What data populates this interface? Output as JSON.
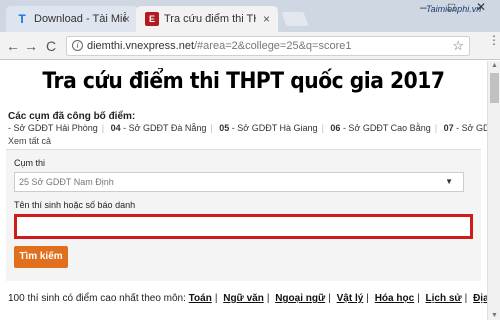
{
  "tabs": [
    {
      "icon": "T",
      "title": "Download - Tài Miễn Phí",
      "close": "×"
    },
    {
      "icon": "E",
      "title": "Tra cứu điểm thi THPT qu",
      "close": "×"
    }
  ],
  "watermark": "Taimienphi.vn",
  "window_controls": {
    "minimize": "–",
    "maximize": "□",
    "close": "✕"
  },
  "toolbar": {
    "back": "←",
    "forward": "→",
    "reload": "C",
    "url_host": "diemthi.vnexpress.net",
    "url_path": "/#area=2&college=25&q=score1",
    "star": "☆",
    "menu": "⋮"
  },
  "page": {
    "heading": "Tra cứu điểm thi THPT quốc gia 2017",
    "clusters_title": "Các cụm đã công bố điểm:",
    "clusters": [
      {
        "num": "",
        "name": "- Sở GDĐT Hải Phòng"
      },
      {
        "num": "04",
        "name": " - Sở GDĐT Đà Nẵng"
      },
      {
        "num": "05",
        "name": " - Sở GDĐT Hà Giang"
      },
      {
        "num": "06",
        "name": " - Sở GDĐT Cao Bằng"
      },
      {
        "num": "07",
        "name": " - Sở GDĐT La"
      }
    ],
    "see_all": "Xem tất cả",
    "cluster_label": "Cụm thi",
    "cluster_value": "25 Sở GDĐT Nam Định",
    "name_label": "Tên thí sinh hoặc số báo danh",
    "name_value": "",
    "search_button": "Tìm kiếm",
    "subjects_intro": "100 thí sinh có điểm cao nhất theo môn:",
    "subjects": [
      "Toán",
      "Ngữ văn",
      "Ngoại ngữ",
      "Vật lý",
      "Hóa học",
      "Lịch sử",
      "Địa lý"
    ]
  }
}
